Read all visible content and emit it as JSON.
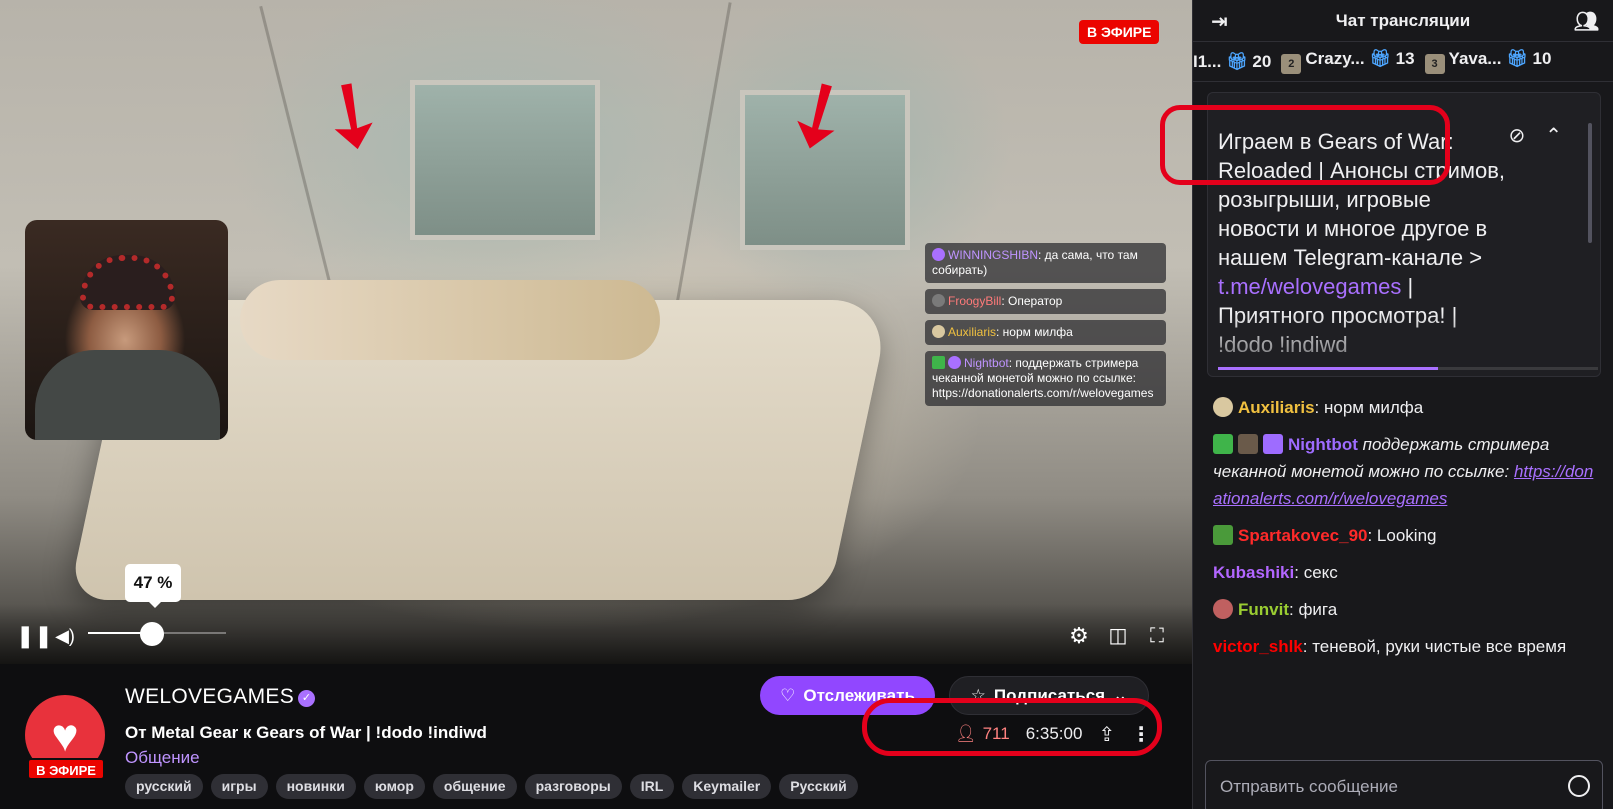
{
  "player": {
    "live_label": "В ЭФИРЕ",
    "volume_percent": 47,
    "volume_tooltip": "47 %",
    "overlay_chat": [
      {
        "user": "WINNINGSHIBN",
        "text": ": да сама, что там собирать)"
      },
      {
        "user": "FroogyBill",
        "text": ": Оператор"
      },
      {
        "user": "Auxiliaris",
        "text": ": норм милфа"
      },
      {
        "user": "Nightbot",
        "text": ": поддержать стримера чеканной монетой можно по ссылке: https://donationalerts.com/r/welovegames"
      }
    ]
  },
  "channel": {
    "name": "WELOVEGAMES",
    "live_badge": "В ЭФИРЕ",
    "title": "От Metal Gear к Gears of War | !dodo !indiwd",
    "category": "Общение",
    "tags": [
      "русский",
      "игры",
      "новинки",
      "юмор",
      "общение",
      "разговоры",
      "IRL",
      "Keymailer",
      "Русский"
    ],
    "follow_label": "Отслеживать",
    "subscribe_label": "Подписаться",
    "viewers": "711",
    "uptime": "6:35:00"
  },
  "chat": {
    "title": "Чат трансляции",
    "leaderboard": [
      {
        "name": "I1...",
        "count": "20",
        "rank": ""
      },
      {
        "name": "Crazy...",
        "count": "13",
        "rank": "2"
      },
      {
        "name": "Yava...",
        "count": "10",
        "rank": "3"
      }
    ],
    "pinned": {
      "text_main": "Играем в Gears of War: Reloaded | Анонсы стримов, розыгрыши, игровые новости и многое другое в нашем Telegram-канале > ",
      "link": "t.me/welovegames",
      "text_after": " | Приятного просмотра! | !dodo !indiwd",
      "progress": 0.58
    },
    "messages": [
      {
        "user": "Auxiliaris",
        "color": "#f0c040",
        "text": ": норм милфа",
        "italic": false,
        "badge_color": "#d9c8a0"
      },
      {
        "user": "Nightbot",
        "color": "#9e6cff",
        "text": " поддержать стримера чеканной монетой можно по ссылке: ",
        "link": "https://donationalerts.com/r/welovegames",
        "italic": true,
        "badge_color": "#3fb44a"
      },
      {
        "user": "Spartakovec_90",
        "color": "#ff2a2a",
        "text": ": Looking",
        "italic": false,
        "badge_color": "#4a9a3a"
      },
      {
        "user": "Kubashiki",
        "color": "#b266ff",
        "text": ": секс",
        "italic": false,
        "badge_color": ""
      },
      {
        "user": "Funvit",
        "color": "#9acd32",
        "text": ": фига",
        "italic": false,
        "badge_color": "#c06060"
      },
      {
        "user": "victor_shlk",
        "color": "#ff0000",
        "text": ": теневой, руки чистые все время",
        "italic": false,
        "badge_color": ""
      }
    ],
    "input_placeholder": "Отправить сообщение"
  },
  "colors": {
    "accent": "#9147ff",
    "live": "#eb0400",
    "annotation": "#e4001b"
  }
}
